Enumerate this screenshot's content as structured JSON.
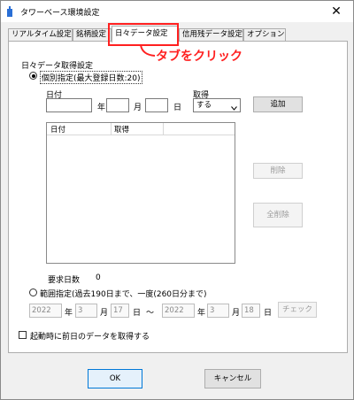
{
  "window": {
    "title": "タワーベース環境設定",
    "close_glyph": "✕"
  },
  "tabs": [
    {
      "label": "リアルタイム設定"
    },
    {
      "label": "銘柄設定"
    },
    {
      "label": "日々データ設定"
    },
    {
      "label": "信用残データ設定"
    },
    {
      "label": "オプション"
    }
  ],
  "annotation": {
    "text": "タブをクリック",
    "color": "#ff2020"
  },
  "group": {
    "title": "日々データ取得設定",
    "individual": {
      "label": "個別指定(最大登録日数:20)",
      "date_label": "日付",
      "year_unit": "年",
      "month_unit": "月",
      "day_unit": "日",
      "year_value": "",
      "month_value": "",
      "day_value": "",
      "acquire_label": "取得",
      "acquire_value": "する",
      "add_button": "追加",
      "list_columns": [
        "日付",
        "取得"
      ],
      "delete_button": "削除",
      "delete_all_button": "全削除",
      "requested_days_label": "要求日数",
      "requested_days_value": "0"
    },
    "range": {
      "label": "範囲指定(過去190日まで、一度(260日分まで)",
      "from_year": "2022",
      "from_month": "3",
      "from_day": "17",
      "to_year": "2022",
      "to_month": "3",
      "to_day": "18",
      "year_unit": "年",
      "month_unit": "月",
      "day_unit": "日",
      "tilde": "～",
      "check_button": "チェック"
    }
  },
  "startup_checkbox": {
    "label": "起動時に前日のデータを取得する",
    "checked": false
  },
  "footer": {
    "ok_button": "OK",
    "cancel_button": "キャンセル"
  },
  "icons": {
    "app": "app-icon",
    "close": "close-icon",
    "dropdown": "chevron-down-icon",
    "arrow": "annotation-arrow-icon"
  }
}
